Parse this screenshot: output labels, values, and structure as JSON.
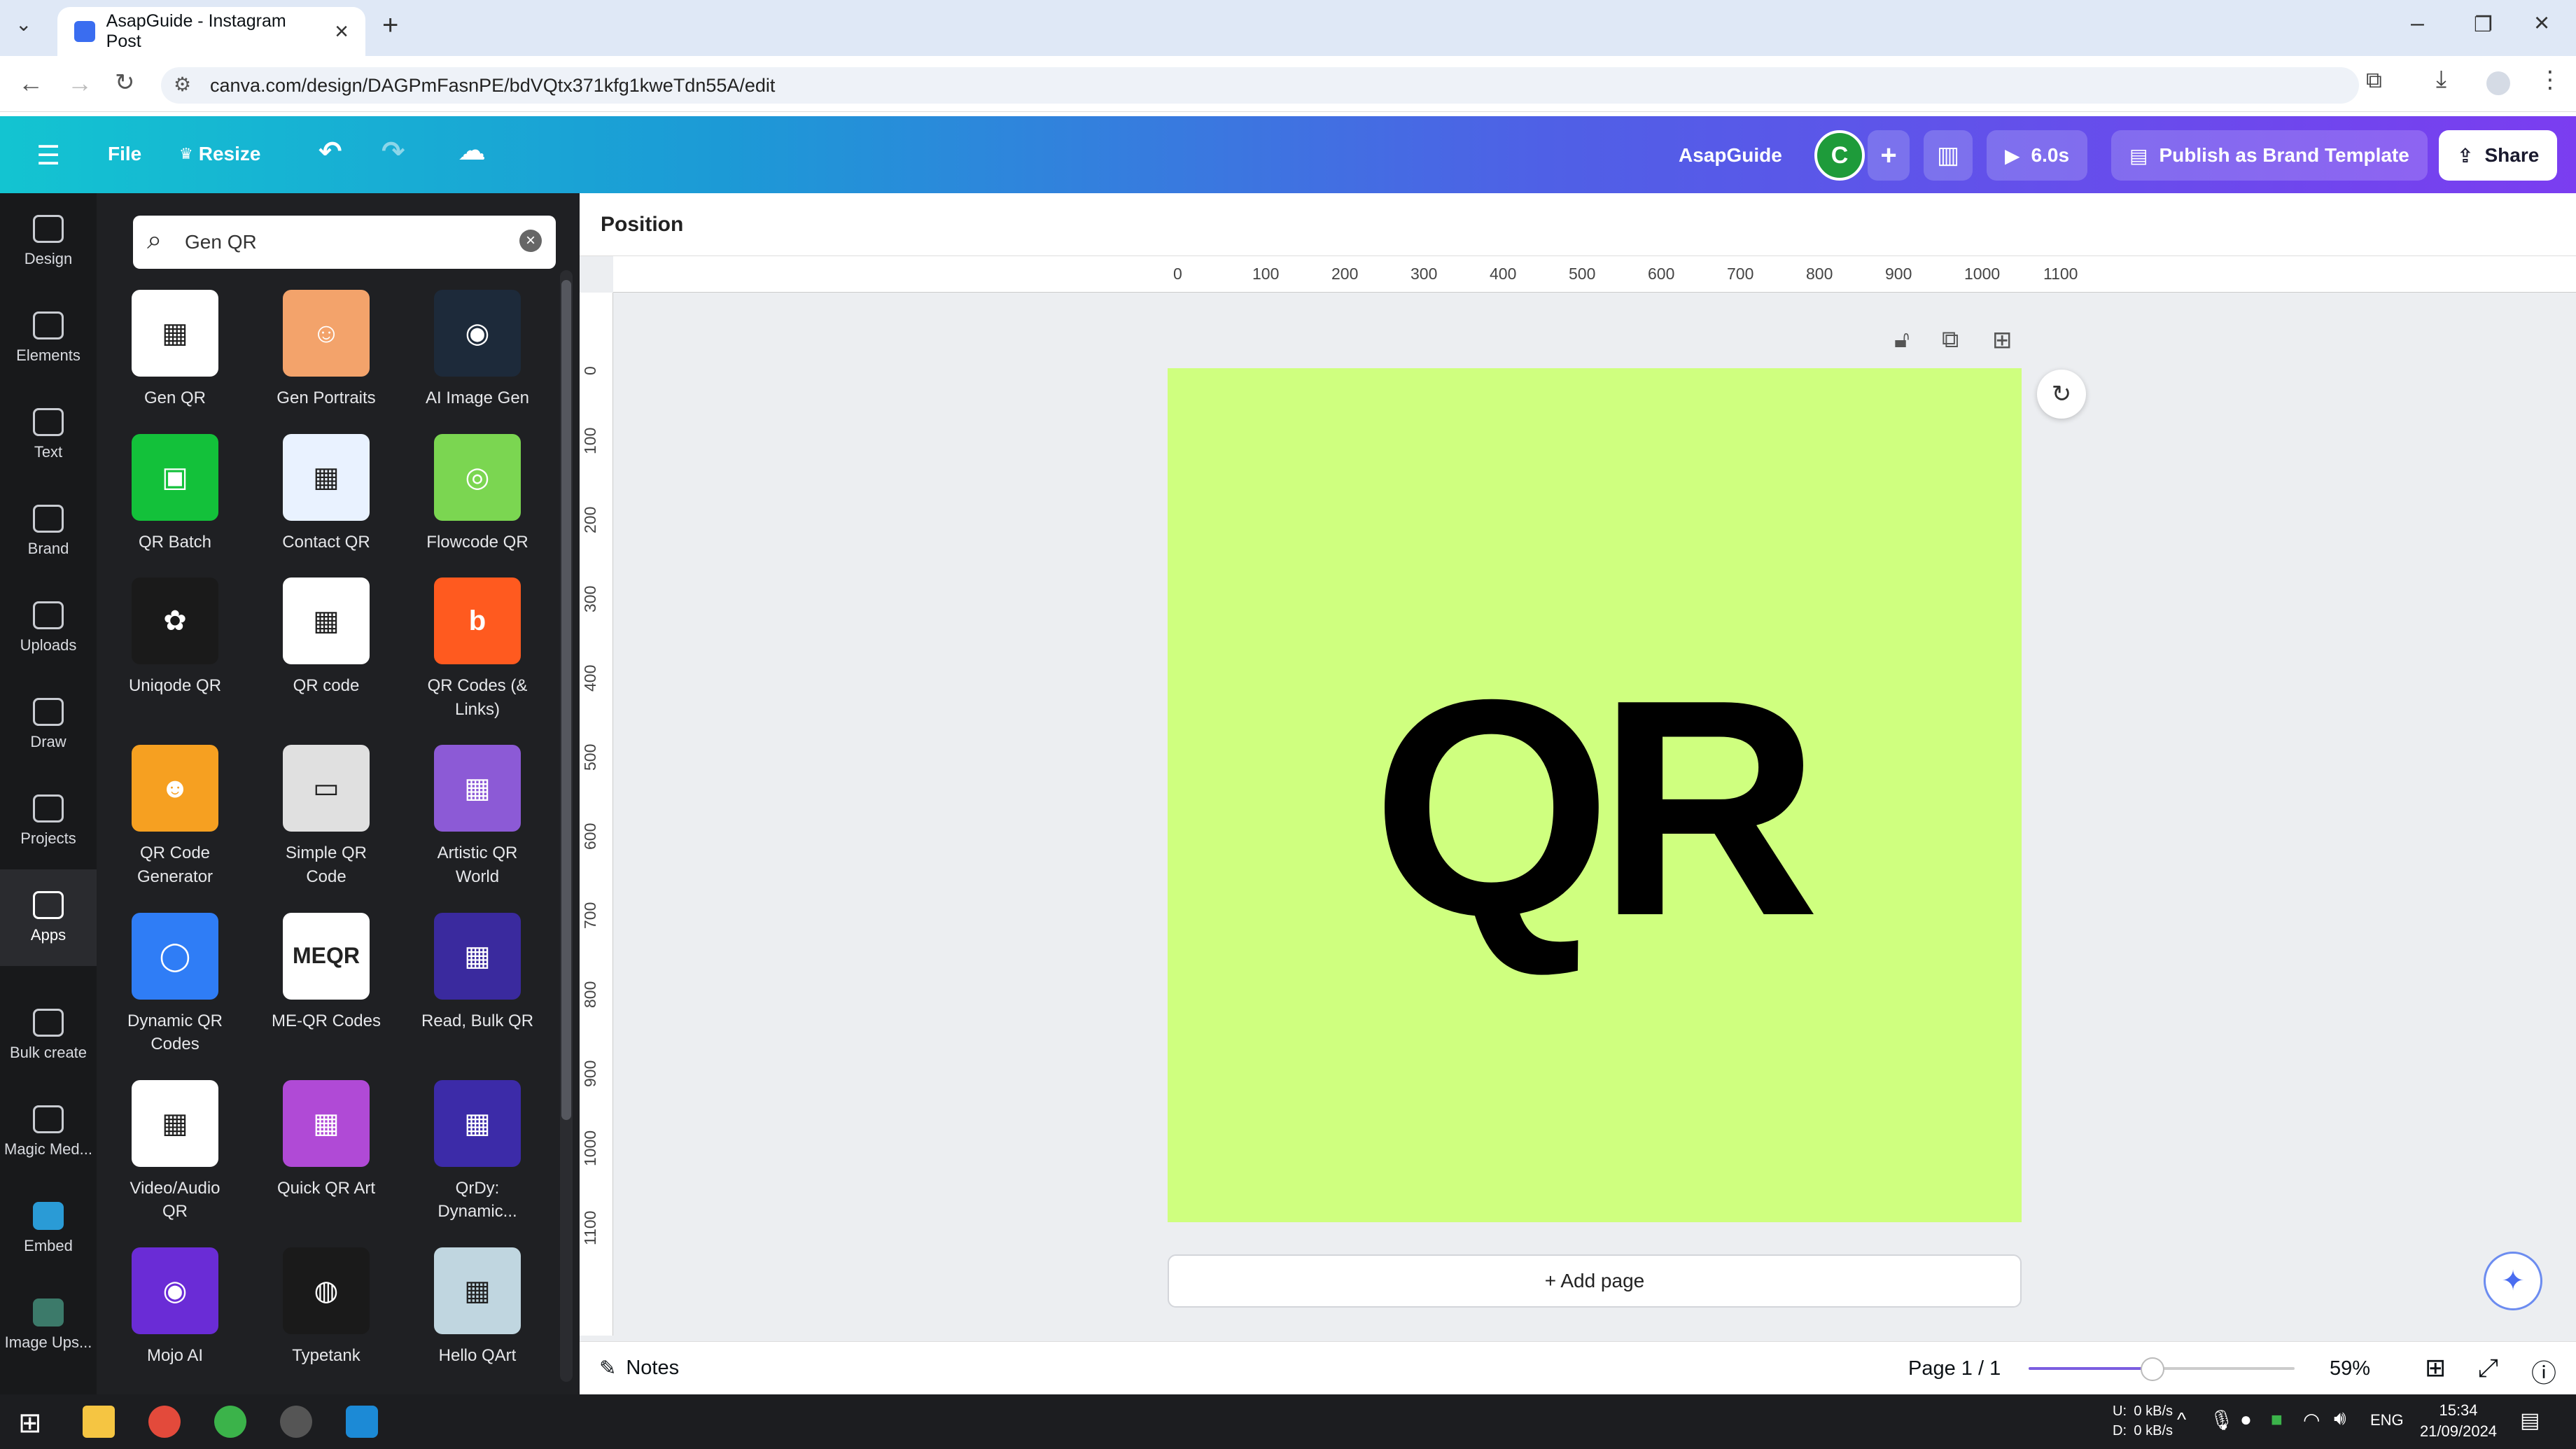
{
  "browser": {
    "tab_title": "AsapGuide - Instagram Post",
    "url": "canva.com/design/DAGPmFasnPE/bdVQtx371kfg1kweTdn55A/edit"
  },
  "topbar": {
    "file": "File",
    "resize": "Resize",
    "brand_name": "AsapGuide",
    "avatar_letter": "C",
    "duration": "6.0s",
    "publish": "Publish as Brand Template",
    "share": "Share"
  },
  "rail": [
    {
      "label": "Design",
      "name": "design"
    },
    {
      "label": "Elements",
      "name": "elements"
    },
    {
      "label": "Text",
      "name": "text"
    },
    {
      "label": "Brand",
      "name": "brand"
    },
    {
      "label": "Uploads",
      "name": "uploads"
    },
    {
      "label": "Draw",
      "name": "draw"
    },
    {
      "label": "Projects",
      "name": "projects"
    },
    {
      "label": "Apps",
      "name": "apps"
    },
    {
      "label": "Bulk create",
      "name": "bulk-create"
    },
    {
      "label": "Magic Med...",
      "name": "magic-media"
    },
    {
      "label": "Embed",
      "name": "embed"
    },
    {
      "label": "Image Ups...",
      "name": "image-upscaler"
    }
  ],
  "search": {
    "value": "Gen QR"
  },
  "apps": [
    {
      "label": "Gen QR",
      "color": "#ffffff",
      "glyph": "▦"
    },
    {
      "label": "Gen Portraits",
      "color": "#f3a36b",
      "glyph": "☺"
    },
    {
      "label": "AI Image Gen",
      "color": "#1d2a3a",
      "glyph": "◉"
    },
    {
      "label": "QR Batch",
      "color": "#13c13a",
      "glyph": "▣"
    },
    {
      "label": "Contact QR",
      "color": "#e9f2ff",
      "glyph": "▦"
    },
    {
      "label": "Flowcode QR",
      "color": "#7bd651",
      "glyph": "◎"
    },
    {
      "label": "Uniqode QR",
      "color": "#1a1a1a",
      "glyph": "✿"
    },
    {
      "label": "QR code",
      "color": "#ffffff",
      "glyph": "▦"
    },
    {
      "label": "QR Codes (& Links)",
      "color": "#ff5a1f",
      "glyph": "b"
    },
    {
      "label": "QR Code Generator",
      "color": "#f6a021",
      "glyph": "☻"
    },
    {
      "label": "Simple QR Code",
      "color": "#e0e0e0",
      "glyph": "▭"
    },
    {
      "label": "Artistic QR World",
      "color": "#8c5ad6",
      "glyph": "▦"
    },
    {
      "label": "Dynamic QR Codes",
      "color": "#2f7df6",
      "glyph": "◯"
    },
    {
      "label": "ME-QR Codes",
      "color": "#ffffff",
      "glyph": "MEQR"
    },
    {
      "label": "Read, Bulk QR",
      "color": "#3a2a9e",
      "glyph": "▦"
    },
    {
      "label": "Video/Audio QR",
      "color": "#ffffff",
      "glyph": "▦"
    },
    {
      "label": "Quick QR Art",
      "color": "#b04ad6",
      "glyph": "▦"
    },
    {
      "label": "QrDy: Dynamic...",
      "color": "#3c2ba8",
      "glyph": "▦"
    },
    {
      "label": "Mojo AI",
      "color": "#6a2cd6",
      "glyph": "◉"
    },
    {
      "label": "Typetank",
      "color": "#1a1a1a",
      "glyph": "◍"
    },
    {
      "label": "Hello QArt",
      "color": "#c0d6e0",
      "glyph": "▦"
    }
  ],
  "canvas": {
    "position_label": "Position",
    "ruler_h": [
      "0",
      "100",
      "200",
      "300",
      "400",
      "500",
      "600",
      "700",
      "800",
      "900",
      "1000",
      "1100"
    ],
    "ruler_v": [
      "0",
      "100",
      "200",
      "300",
      "400",
      "500",
      "600",
      "700",
      "800",
      "900",
      "1000",
      "1100"
    ],
    "page_text": "QR",
    "page_color": "#cfff7f",
    "add_page": "+ Add page"
  },
  "bottombar": {
    "notes": "Notes",
    "page_indicator": "Page 1 / 1",
    "zoom": "59%"
  },
  "taskbar": {
    "net_up": "0 kB/s",
    "net_down": "0 kB/s",
    "net_up_label": "U:",
    "net_down_label": "D:",
    "lang": "ENG",
    "time": "15:34",
    "date": "21/09/2024"
  }
}
